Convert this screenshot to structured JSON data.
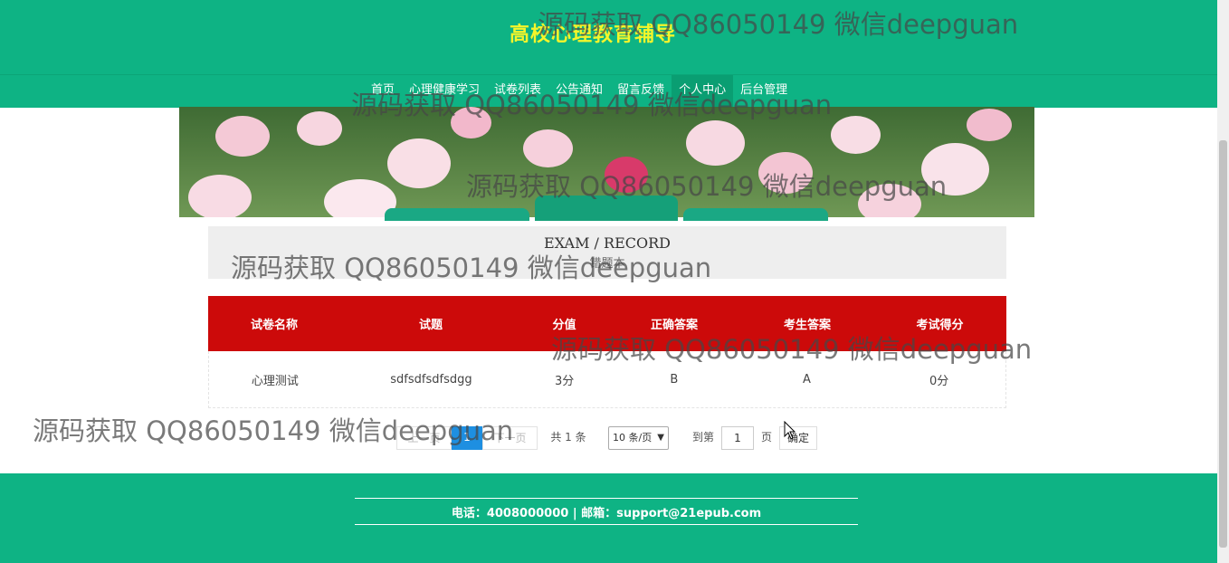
{
  "header": {
    "site_title": "高校心理教育辅导"
  },
  "nav": {
    "items": [
      {
        "label": "首页"
      },
      {
        "label": "心理健康学习"
      },
      {
        "label": "试卷列表"
      },
      {
        "label": "公告通知"
      },
      {
        "label": "留言反馈"
      },
      {
        "label": "个人中心"
      },
      {
        "label": "后台管理"
      }
    ],
    "active_index": 5
  },
  "section": {
    "title_en": "EXAM / RECORD",
    "title_cn": "错题本"
  },
  "table": {
    "headers": [
      "试卷名称",
      "试题",
      "分值",
      "正确答案",
      "考生答案",
      "考试得分"
    ],
    "rows": [
      [
        "心理测试",
        "sdfsdfsdfsdgg",
        "3分",
        "B",
        "A",
        "0分"
      ]
    ]
  },
  "pagination": {
    "prev_label": "上一页",
    "current_page": "1",
    "next_label": "下一页",
    "total_label": "共 1 条",
    "page_size_selected": "10 条/页",
    "goto_label": "到第",
    "goto_value": "1",
    "page_unit": "页",
    "confirm_label": "确定"
  },
  "footer": {
    "contact": "电话：4008000000 | 邮箱：support@21epub.com"
  },
  "watermark": {
    "text": "源码获取 QQ86050149 微信deepguan"
  },
  "colors": {
    "primary": "#0eb384",
    "table_header": "#cc0a0a",
    "title_yellow": "#f5f52a",
    "page_active": "#1e8fe1"
  }
}
